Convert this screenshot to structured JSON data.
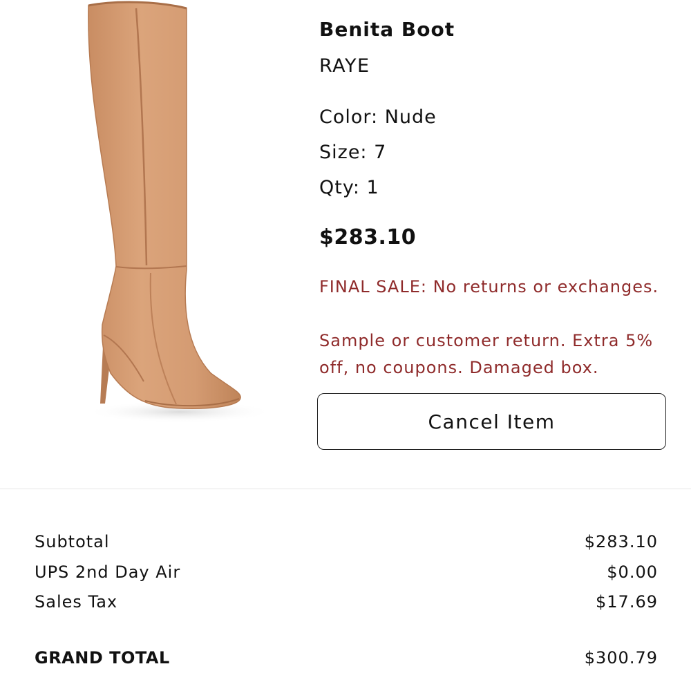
{
  "product": {
    "title": "Benita Boot",
    "brand": "RAYE",
    "color": "Color: Nude",
    "size": "Size: 7",
    "qty": "Qty: 1",
    "price": "$283.10",
    "final_sale": "FINAL SALE: No returns or exchanges.",
    "sample_note": "Sample or customer return. Extra 5% off, no coupons. Damaged box.",
    "image_color": "#d09a72"
  },
  "actions": {
    "cancel_label": "Cancel Item"
  },
  "summary": {
    "rows": [
      {
        "label": "Subtotal",
        "value": "$283.10"
      },
      {
        "label": "UPS 2nd Day Air",
        "value": "$0.00"
      },
      {
        "label": "Sales Tax",
        "value": "$17.69"
      }
    ],
    "grand_total": {
      "label": "GRAND TOTAL",
      "value": "$300.79"
    }
  }
}
